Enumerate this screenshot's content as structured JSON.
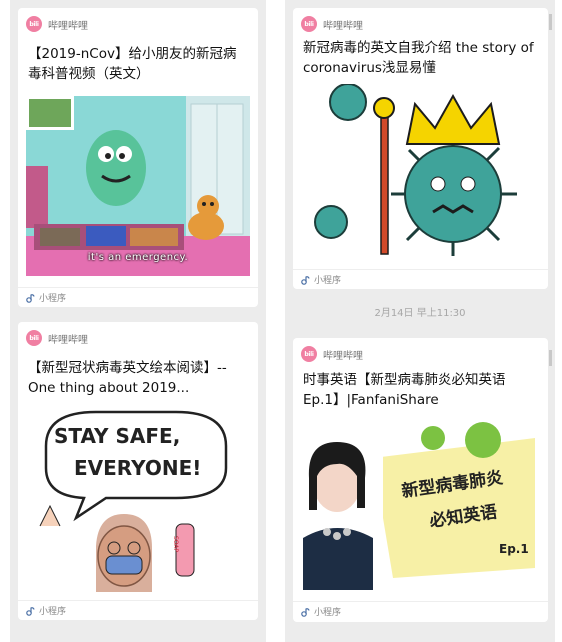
{
  "cards": [
    {
      "app_name": "哔哩哔哩",
      "logo_text": "bili",
      "title": "【2019-nCov】给小朋友的新冠病毒科普视频（英文）",
      "subtitle_caption": "it's an emergency.",
      "footer_label": "小程序"
    },
    {
      "app_name": "哔哩哔哩",
      "logo_text": "bili",
      "title": "新冠病毒的英文自我介绍 the story of coronavirus浅显易懂",
      "footer_label": "小程序"
    },
    {
      "app_name": "哔哩哔哩",
      "logo_text": "bili",
      "title": "【新型冠状病毒英文绘本阅读】--One thing about 2019...",
      "bubble_line1": "STAY SAFE,",
      "bubble_line2": "EVERYONE!",
      "soap_label": "SOAP",
      "footer_label": "小程序"
    },
    {
      "app_name": "哔哩哔哩",
      "logo_text": "bili",
      "title": "时事英语【新型病毒肺炎必知英语 Ep.1】|FanfaniShare",
      "poster_line1": "新型病毒肺炎",
      "poster_line2": "必知英语",
      "poster_ep": "Ep.1",
      "footer_label": "小程序"
    }
  ],
  "timestamp": "2月14日 早上11:30",
  "colors": {
    "bili_pink": "#f07fa2",
    "virus_green": "#3fa39a",
    "crown_yellow": "#f5d400"
  }
}
